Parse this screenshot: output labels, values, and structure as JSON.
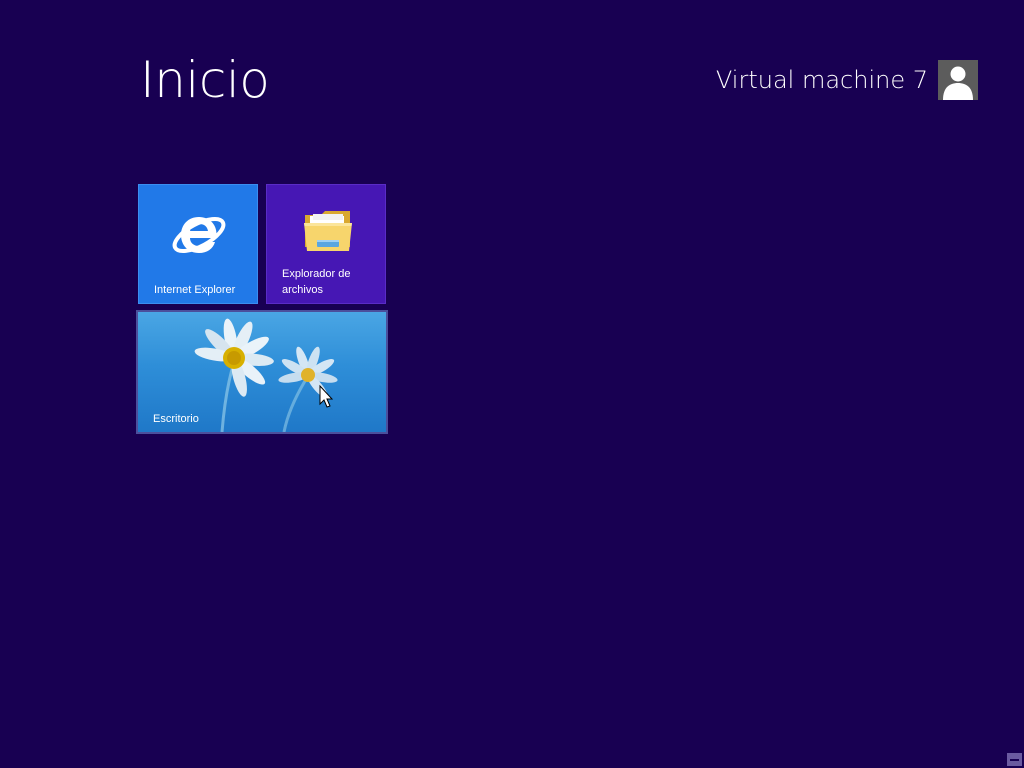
{
  "header": {
    "title": "Inicio",
    "user_name": "Virtual machine 7",
    "avatar_icon": "user-silhouette-icon"
  },
  "tiles": [
    {
      "label": "Internet Explorer",
      "icon": "internet-explorer-icon",
      "color": "#2179e8"
    },
    {
      "label": "Explorador de archivos",
      "icon": "folder-icon",
      "color": "#4617b4"
    },
    {
      "label": "Escritorio",
      "icon": "desktop-wallpaper",
      "color": "#2e8ed8"
    }
  ],
  "theme": {
    "background": "#180052"
  },
  "cursor": {
    "icon": "mouse-pointer-icon"
  }
}
